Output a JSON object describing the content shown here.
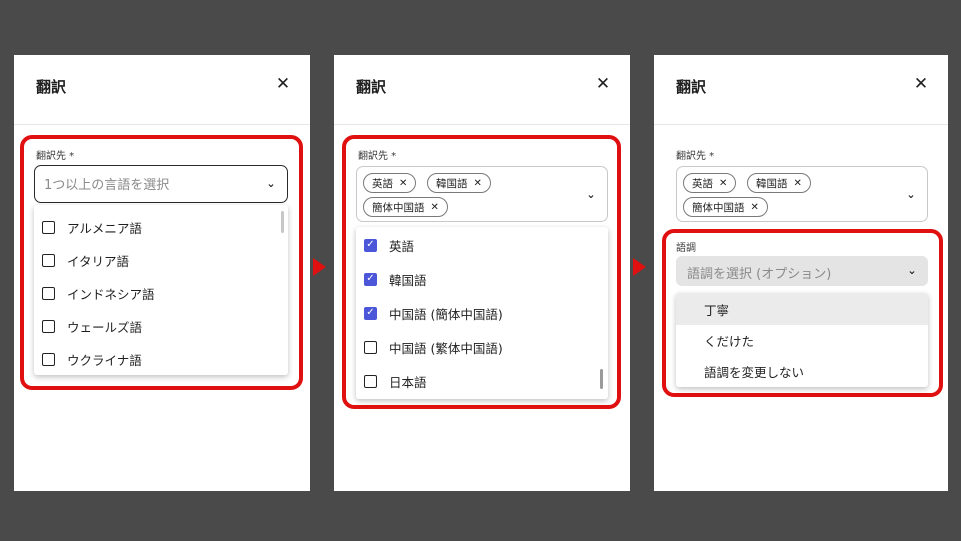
{
  "dialog": {
    "title": "翻訳",
    "close_icon": "✕"
  },
  "step1": {
    "label": "翻訳先 *",
    "placeholder": "1つ以上の言語を選択",
    "options": [
      "アルメニア語",
      "イタリア語",
      "インドネシア語",
      "ウェールズ語",
      "ウクライナ語"
    ]
  },
  "step2": {
    "label": "翻訳先 *",
    "chips": [
      "英語",
      "韓国語",
      "簡体中国語"
    ],
    "options": [
      {
        "label": "英語",
        "checked": true
      },
      {
        "label": "韓国語",
        "checked": true
      },
      {
        "label": "中国語 (簡体中国語)",
        "checked": true
      },
      {
        "label": "中国語 (繁体中国語)",
        "checked": false
      },
      {
        "label": "日本語",
        "checked": false
      }
    ]
  },
  "step3": {
    "label": "翻訳先 *",
    "chips": [
      "英語",
      "韓国語",
      "簡体中国語"
    ],
    "tone_label": "語調",
    "tone_placeholder": "語調を選択 (オプション)",
    "tone_options": [
      "丁寧",
      "くだけた",
      "語調を変更しない"
    ]
  },
  "colors": {
    "highlight": "#e01010",
    "checkbox": "#4b57d8",
    "background": "#4a4a4a"
  }
}
